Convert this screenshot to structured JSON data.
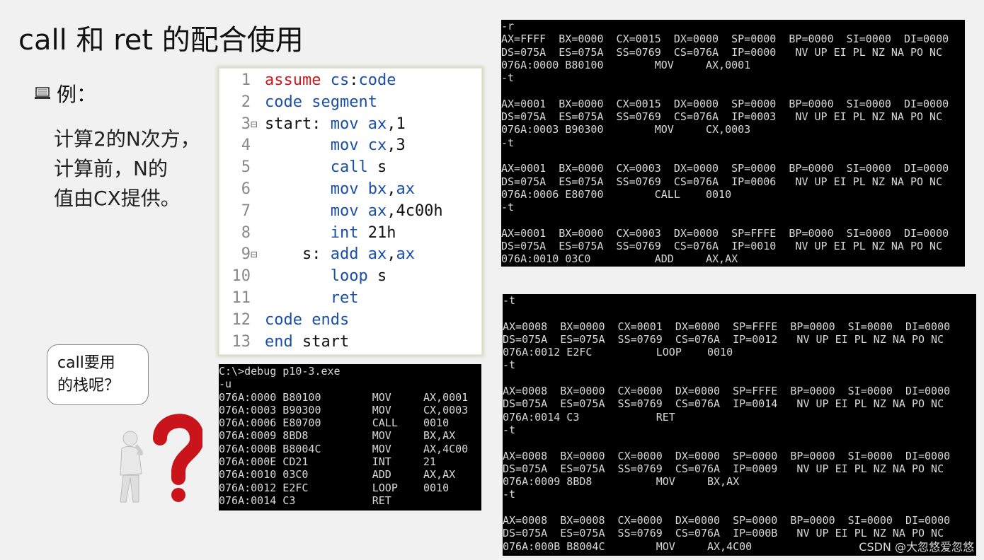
{
  "slide": {
    "title": "call 和 ret 的配合使用",
    "example_label": "例：",
    "description_lines": [
      "计算2的N次方，",
      "计算前，N的",
      "值由CX提供。"
    ],
    "bubble_lines": [
      "call要用",
      "的栈呢？"
    ],
    "watermark": "CSDN @大忽悠爱忽悠"
  },
  "code_editor": {
    "lines": [
      {
        "num": "1",
        "fold": "",
        "segments": [
          {
            "t": "assume ",
            "c": "red"
          },
          {
            "t": "cs",
            "c": "kw"
          },
          {
            "t": ":",
            "c": "blk"
          },
          {
            "t": "code",
            "c": "kw"
          }
        ]
      },
      {
        "num": "2",
        "fold": "",
        "segments": [
          {
            "t": "code segment",
            "c": "kw"
          }
        ]
      },
      {
        "num": "3",
        "fold": "⊟",
        "segments": [
          {
            "t": "start: ",
            "c": "blk"
          },
          {
            "t": "mov ",
            "c": "kw"
          },
          {
            "t": "ax",
            "c": "kw"
          },
          {
            "t": ",1",
            "c": "blk"
          }
        ]
      },
      {
        "num": "4",
        "fold": "",
        "segments": [
          {
            "t": "       mov ",
            "c": "kw"
          },
          {
            "t": "cx",
            "c": "kw"
          },
          {
            "t": ",3",
            "c": "blk"
          }
        ]
      },
      {
        "num": "5",
        "fold": "",
        "segments": [
          {
            "t": "       call ",
            "c": "kw"
          },
          {
            "t": "s",
            "c": "blk"
          }
        ]
      },
      {
        "num": "6",
        "fold": "",
        "segments": [
          {
            "t": "       mov ",
            "c": "kw"
          },
          {
            "t": "bx",
            "c": "kw"
          },
          {
            "t": ",",
            "c": "blk"
          },
          {
            "t": "ax",
            "c": "kw"
          }
        ]
      },
      {
        "num": "7",
        "fold": "",
        "segments": [
          {
            "t": "       mov ",
            "c": "kw"
          },
          {
            "t": "ax",
            "c": "kw"
          },
          {
            "t": ",4c00h",
            "c": "blk"
          }
        ]
      },
      {
        "num": "8",
        "fold": "",
        "segments": [
          {
            "t": "       int ",
            "c": "kw"
          },
          {
            "t": "21h",
            "c": "blk"
          }
        ]
      },
      {
        "num": "9",
        "fold": "⊟",
        "segments": [
          {
            "t": "    s: ",
            "c": "blk"
          },
          {
            "t": "add ",
            "c": "kw"
          },
          {
            "t": "ax",
            "c": "kw"
          },
          {
            "t": ",",
            "c": "blk"
          },
          {
            "t": "ax",
            "c": "kw"
          }
        ]
      },
      {
        "num": "10",
        "fold": "",
        "segments": [
          {
            "t": "       loop ",
            "c": "kw"
          },
          {
            "t": "s",
            "c": "blk"
          }
        ]
      },
      {
        "num": "11",
        "fold": "",
        "segments": [
          {
            "t": "       ret",
            "c": "kw"
          }
        ]
      },
      {
        "num": "12",
        "fold": "",
        "segments": [
          {
            "t": "code ends",
            "c": "kw"
          }
        ]
      },
      {
        "num": "13",
        "fold": "",
        "segments": [
          {
            "t": "end ",
            "c": "kw"
          },
          {
            "t": "start",
            "c": "blk"
          }
        ]
      }
    ]
  },
  "terminal_disasm": {
    "lines": [
      "C:\\>debug p10-3.exe",
      "-u",
      "076A:0000 B80100        MOV     AX,0001",
      "076A:0003 B90300        MOV     CX,0003",
      "076A:0006 E80700        CALL    0010",
      "076A:0009 8BD8          MOV     BX,AX",
      "076A:000B B8004C        MOV     AX,4C00",
      "076A:000E CD21          INT     21",
      "076A:0010 03C0          ADD     AX,AX",
      "076A:0012 E2FC          LOOP    0010",
      "076A:0014 C3            RET"
    ]
  },
  "terminal_trace1": {
    "lines": [
      "-r",
      "AX=FFFF  BX=0000  CX=0015  DX=0000  SP=0000  BP=0000  SI=0000  DI=0000",
      "DS=075A  ES=075A  SS=0769  CS=076A  IP=0000   NV UP EI PL NZ NA PO NC",
      "076A:0000 B80100        MOV     AX,0001",
      "-t",
      "",
      "AX=0001  BX=0000  CX=0015  DX=0000  SP=0000  BP=0000  SI=0000  DI=0000",
      "DS=075A  ES=075A  SS=0769  CS=076A  IP=0003   NV UP EI PL NZ NA PO NC",
      "076A:0003 B90300        MOV     CX,0003",
      "-t",
      "",
      "AX=0001  BX=0000  CX=0003  DX=0000  SP=0000  BP=0000  SI=0000  DI=0000",
      "DS=075A  ES=075A  SS=0769  CS=076A  IP=0006   NV UP EI PL NZ NA PO NC",
      "076A:0006 E80700        CALL    0010",
      "-t",
      "",
      "AX=0001  BX=0000  CX=0003  DX=0000  SP=FFFE  BP=0000  SI=0000  DI=0000",
      "DS=075A  ES=075A  SS=0769  CS=076A  IP=0010   NV UP EI PL NZ NA PO NC",
      "076A:0010 03C0          ADD     AX,AX"
    ]
  },
  "terminal_trace2": {
    "lines": [
      "-t",
      "",
      "AX=0008  BX=0000  CX=0001  DX=0000  SP=FFFE  BP=0000  SI=0000  DI=0000",
      "DS=075A  ES=075A  SS=0769  CS=076A  IP=0012   NV UP EI PL NZ NA PO NC",
      "076A:0012 E2FC          LOOP    0010",
      "-t",
      "",
      "AX=0008  BX=0000  CX=0000  DX=0000  SP=FFFE  BP=0000  SI=0000  DI=0000",
      "DS=075A  ES=075A  SS=0769  CS=076A  IP=0014   NV UP EI PL NZ NA PO NC",
      "076A:0014 C3            RET",
      "-t",
      "",
      "AX=0008  BX=0000  CX=0000  DX=0000  SP=0000  BP=0000  SI=0000  DI=0000",
      "DS=075A  ES=075A  SS=0769  CS=076A  IP=0009   NV UP EI PL NZ NA PO NC",
      "076A:0009 8BD8          MOV     BX,AX",
      "-t",
      "",
      "AX=0008  BX=0008  CX=0000  DX=0000  SP=0000  BP=0000  SI=0000  DI=0000",
      "DS=075A  ES=075A  SS=0769  CS=076A  IP=000B   NV UP EI PL NZ NA PO NC",
      "076A:000B B8004C        MOV     AX,4C00"
    ]
  }
}
